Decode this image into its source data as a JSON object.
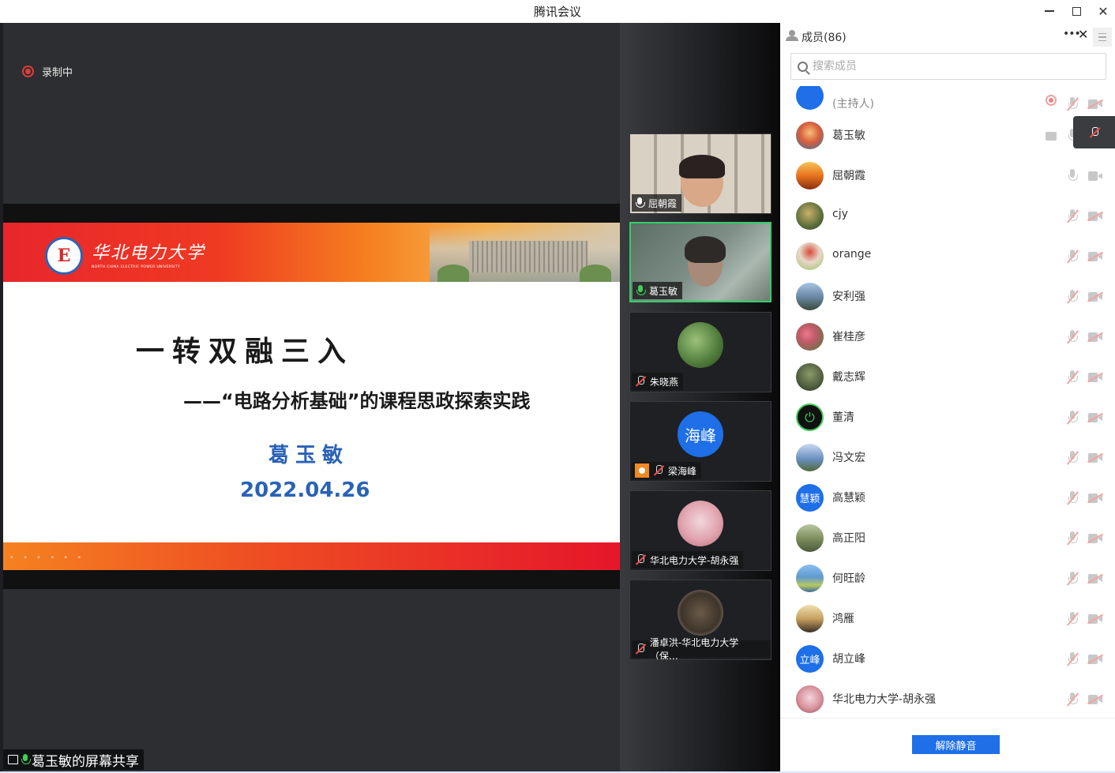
{
  "window": {
    "title": "腾讯会议"
  },
  "stage": {
    "recording_label": "录制中",
    "share_label": "葛玉敏的屏幕共享",
    "slide": {
      "university_name": "华北电力大学",
      "university_english": "NORTH CHINA ELECTRIC POWER UNIVERSITY",
      "logo_letter": "E",
      "title": "一转双融三入",
      "subtitle": "——“电路分析基础”的课程思政探索实践",
      "author": "葛玉敏",
      "date": "2022.04.26"
    }
  },
  "video_tiles": [
    {
      "name": "屈朝霞",
      "mic": "on"
    },
    {
      "name": "葛玉敏",
      "mic": "active"
    },
    {
      "name": "朱晓燕",
      "mic": "off"
    },
    {
      "name": "梁海峰",
      "mic": "off",
      "avatar_text": "海峰"
    },
    {
      "name": "华北电力大学-胡永强",
      "mic": "off"
    },
    {
      "name": "潘卓洪-华北电力大学（保…",
      "mic": "off"
    }
  ],
  "members": {
    "title": "成员(86)",
    "search_placeholder": "搜索成员",
    "unmute_all_label": "解除静音",
    "list": [
      {
        "name": "(主持人)",
        "avatar_color": "#1e6fe8",
        "mic": "muted",
        "cam": "off",
        "extra": "recording"
      },
      {
        "name": "葛玉敏",
        "avatar_color": "#3b6fa8",
        "mic": "on",
        "cam": "off",
        "extra": "screen-share"
      },
      {
        "name": "屈朝霞",
        "avatar_color": "#f0a030",
        "mic": "on",
        "cam": "on"
      },
      {
        "name": "cjy",
        "avatar_color": "#5a6e3a",
        "mic": "muted",
        "cam": "off"
      },
      {
        "name": "orange",
        "avatar_color": "#9bbf6a",
        "mic": "muted",
        "cam": "off"
      },
      {
        "name": "安利强",
        "avatar_color": "#6b8aa8",
        "mic": "muted",
        "cam": "off"
      },
      {
        "name": "崔桂彦",
        "avatar_color": "#c25a6a",
        "mic": "muted",
        "cam": "off"
      },
      {
        "name": "戴志辉",
        "avatar_color": "#4f5e3e",
        "mic": "muted",
        "cam": "off"
      },
      {
        "name": "董清",
        "avatar_color": "#111111",
        "mic": "muted",
        "cam": "off"
      },
      {
        "name": "冯文宏",
        "avatar_color": "#6a8fc0",
        "mic": "muted",
        "cam": "off"
      },
      {
        "name": "高慧颖",
        "avatar_color": "#1e6fe8",
        "mic": "muted",
        "cam": "off",
        "avatar_text": "慧颖"
      },
      {
        "name": "高正阳",
        "avatar_color": "#7a8a5a",
        "mic": "muted",
        "cam": "off"
      },
      {
        "name": "何旺龄",
        "avatar_color": "#5f9ad0",
        "mic": "muted",
        "cam": "off"
      },
      {
        "name": "鸿雁",
        "avatar_color": "#c8a060",
        "mic": "muted",
        "cam": "off"
      },
      {
        "name": "胡立峰",
        "avatar_color": "#1e6fe8",
        "mic": "muted",
        "cam": "off",
        "avatar_text": "立峰"
      },
      {
        "name": "华北电力大学-胡永强",
        "avatar_color": "#d9909a",
        "mic": "muted",
        "cam": "off"
      }
    ]
  },
  "colors": {
    "accent": "#1e6fe8",
    "recording": "#e23b3b",
    "active_speaker": "#2fcf67"
  }
}
